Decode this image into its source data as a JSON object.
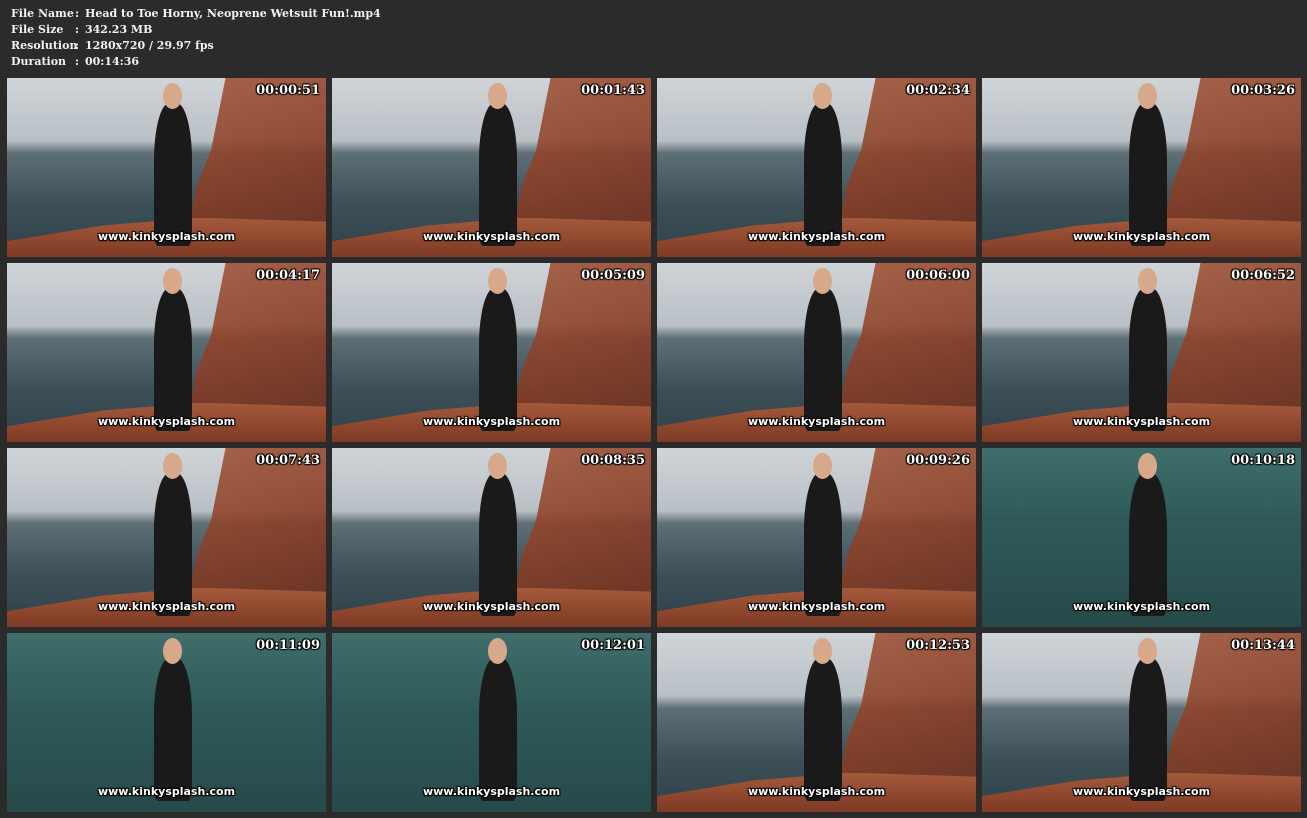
{
  "info": {
    "file_name_label": "File Name",
    "file_name": "Head to Toe Horny, Neoprene Wetsuit Fun!.mp4",
    "file_size_label": "File Size",
    "file_size": "342.23 MB",
    "resolution_label": "Resolution",
    "resolution": "1280x720 / 29.97 fps",
    "duration_label": "Duration",
    "duration": "00:14:36",
    "separator": ":"
  },
  "watermark": "www.kinkysplash.com",
  "thumbnails": [
    {
      "time": "00:00:51"
    },
    {
      "time": "00:01:43"
    },
    {
      "time": "00:02:34"
    },
    {
      "time": "00:03:26"
    },
    {
      "time": "00:04:17"
    },
    {
      "time": "00:05:09"
    },
    {
      "time": "00:06:00"
    },
    {
      "time": "00:06:52"
    },
    {
      "time": "00:07:43"
    },
    {
      "time": "00:08:35"
    },
    {
      "time": "00:09:26"
    },
    {
      "time": "00:10:18"
    },
    {
      "time": "00:11:09"
    },
    {
      "time": "00:12:01"
    },
    {
      "time": "00:12:53"
    },
    {
      "time": "00:13:44"
    }
  ]
}
